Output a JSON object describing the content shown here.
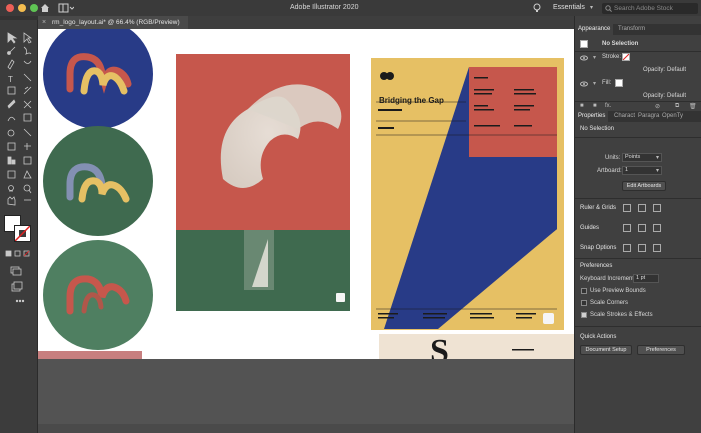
{
  "window": {
    "title": "Adobe Illustrator 2020",
    "workspace": "Essentials",
    "search_placeholder": "Search Adobe Stock",
    "traffic_colors": [
      "#ec5f57",
      "#f4bd4f",
      "#5fc454"
    ]
  },
  "document_tab": {
    "label": "rm_logo_layout.ai* @ 66.4% (RGB/Preview)",
    "close": "×"
  },
  "appearance_panel": {
    "tabs": [
      "Appearance",
      "Transform"
    ],
    "selection": "No Selection",
    "stroke_label": "Stroke:",
    "opacity_label": "Opacity:",
    "opacity_value": "Default",
    "fill_label": "Fill:",
    "fill_opacity_label": "Opacity:",
    "fill_opacity_value": "Default",
    "fx_label": "fx."
  },
  "properties_panel": {
    "tabs": [
      "Properties",
      "Charact",
      "Paragra",
      "OpenTy"
    ],
    "selection": "No Selection",
    "units_label": "Units:",
    "units_value": "Points",
    "artboard_label": "Artboard:",
    "artboard_value": "1",
    "edit_artboards": "Edit Artboards",
    "ruler_grids": "Ruler & Grids",
    "guides": "Guides",
    "snap_options": "Snap Options",
    "preferences_title": "Preferences",
    "keyboard_increment_label": "Keyboard Increment:",
    "keyboard_increment_value": "1 pt",
    "use_preview_bounds": "Use Preview Bounds",
    "scale_corners": "Scale Corners",
    "scale_strokes": "Scale Strokes & Effects",
    "quick_actions": "Quick Actions",
    "document_setup": "Document Setup",
    "preferences_button": "Preferences"
  },
  "poster": {
    "title": "Bridging the Gap",
    "colors": {
      "yellow": "#e6c064",
      "blue": "#283b87",
      "red": "#c6574c"
    }
  },
  "colors": {
    "accent_red": "#c6574c",
    "navy": "#283b87",
    "green": "#3f6a4f",
    "sage": "#4f7f61"
  }
}
